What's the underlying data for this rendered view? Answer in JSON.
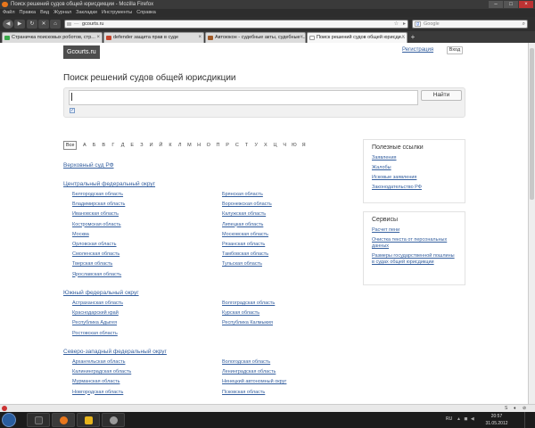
{
  "window": {
    "title": "Поиск решений судов общей юрисдикции - Mozilla Firefox",
    "controls": [
      "–",
      "□",
      "×"
    ]
  },
  "menu": [
    "Файл",
    "Правка",
    "Вид",
    "Журнал",
    "Закладки",
    "Инструменты",
    "Справка"
  ],
  "navbar": {
    "back": "◀",
    "forward": "▶",
    "reload": "↻",
    "stop": "✕",
    "home": "⌂",
    "url_prefix": "—",
    "url": "gcourts.ru",
    "star": "☆",
    "go": "▸",
    "search_placeholder": "Google",
    "search_engine_letter": "g",
    "search_glyph": "⌕"
  },
  "tabs": [
    {
      "label": "Страничка поисковых роботов, стр...",
      "icon_color": "#3aa84a",
      "active": false
    },
    {
      "label": "defender защита прав в суде",
      "icon_color": "#c4452d",
      "active": false
    },
    {
      "label": "Автоюкон - судебные акты, судебные ...",
      "icon_color": "#a05a28",
      "active": false
    },
    {
      "label": "Поиск решений судов общей юрисди...",
      "icon_color": "#ffffff",
      "active": true
    }
  ],
  "tab_close": "×",
  "new_tab": "+",
  "page": {
    "logo": "Gcourts.ru",
    "register": "Регистрация",
    "login": "Вход",
    "title": "Поиск решений судов общей юрисдикции",
    "search_button": "Найти",
    "checkbox_mark": "✓"
  },
  "alphabet": {
    "all": "Все",
    "letters": [
      "А",
      "Б",
      "В",
      "Г",
      "Д",
      "Е",
      "З",
      "И",
      "Й",
      "К",
      "Л",
      "М",
      "Н",
      "О",
      "П",
      "Р",
      "С",
      "Т",
      "У",
      "Х",
      "Ц",
      "Ч",
      "Ю",
      "Я"
    ]
  },
  "supreme_court": "Верховный суд РФ",
  "districts": [
    {
      "name": "Центральный федеральный округ",
      "left": [
        "Белгородская область",
        "Владимирская область",
        "Ивановская область",
        "Костромская область",
        "Москва",
        "Орловская область",
        "Смоленская область",
        "Тверская область",
        "Ярославская область"
      ],
      "right": [
        "Брянская область",
        "Воронежская область",
        "Калужская область",
        "Липецкая область",
        "Московская область",
        "Рязанская область",
        "Тамбовская область",
        "Тульская область"
      ]
    },
    {
      "name": "Южный федеральный округ",
      "left": [
        "Астраханская область",
        "Краснодарский край",
        "Республика Адыгея",
        "Ростовская область"
      ],
      "right": [
        "Волгоградская область",
        "Курская область",
        "Республика Калмыкия"
      ]
    },
    {
      "name": "Северо-западный федеральный округ",
      "left": [
        "Архангельская область",
        "Калининградская область",
        "Мурманская область",
        "Новгородская область"
      ],
      "right": [
        "Вологодская область",
        "Ленинградская область",
        "Ненецкий автономный округ",
        "Псковская область"
      ]
    }
  ],
  "useful_links": {
    "title": "Полезные ссылки",
    "links": [
      "Заявления",
      "Жалобы",
      "Исковые заявления",
      "Законодательство РФ"
    ]
  },
  "services": {
    "title": "Сервисы",
    "links": [
      "Расчет пени",
      "Очистка текста от персональных данных",
      "Размеры государственной пошлины в судах общей юрисдикции"
    ]
  },
  "taskbar": {
    "lang": "RU",
    "tray_icons": "▲ ◼ ◀",
    "time": "20:57",
    "date": "31.05.2012",
    "tasks": [
      {
        "color": "#3f3f3f"
      },
      {
        "color": "#e8761c"
      },
      {
        "color": "#e6b41c"
      },
      {
        "color": "#9a9a9a"
      }
    ]
  },
  "notify": {
    "items": [
      "S",
      "♦",
      "⊘"
    ]
  }
}
